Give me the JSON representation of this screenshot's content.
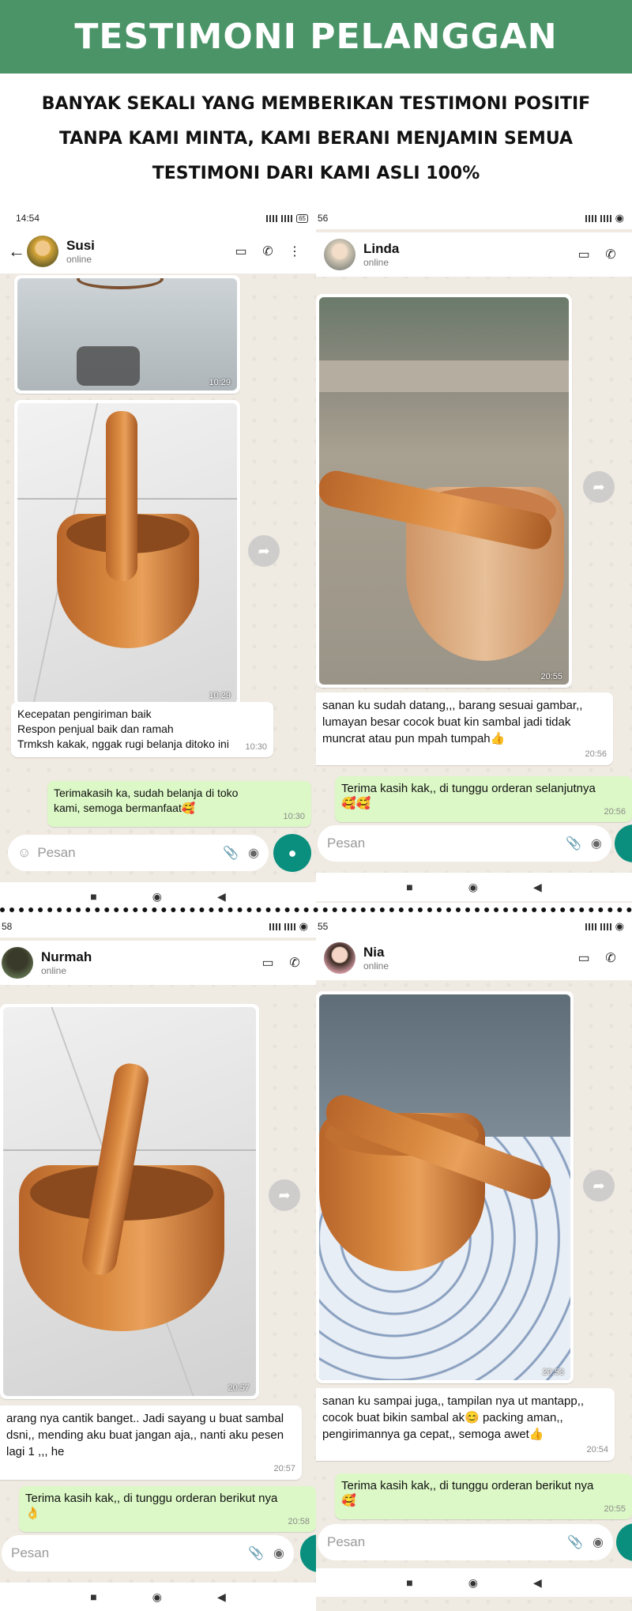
{
  "banner": {
    "title": "TESTIMONI PELANGGAN"
  },
  "subtitle": {
    "line1": "BANYAK SEKALI YANG MEMBERIKAN TESTIMONI POSITIF",
    "line2": "TANPA KAMI MINTA, KAMI BERANI MENJAMIN SEMUA",
    "line3": "TESTIMONI DARI KAMI ASLI 100%"
  },
  "colors": {
    "banner": "#4a9468",
    "incoming": "#ffffff",
    "outgoing": "#dcf8c6",
    "chat_bg": "#efeae2",
    "mic": "#0a8f7e"
  },
  "common": {
    "placeholder": "Pesan",
    "status": "online",
    "back_icon": "arrow-left-icon",
    "video_icon": "video-call-icon",
    "call_icon": "phone-icon"
  },
  "chat1": {
    "clock": "14:54",
    "name": "Susi",
    "status": "online",
    "photo1_time": "10:29",
    "photo2_time": "10:29",
    "msg_in": [
      "Kecepatan pengiriman baik",
      "Respon penjual baik dan ramah",
      "Trmksh kakak, nggak rugi belanja ditoko ini"
    ],
    "msg_in_time": "10:30",
    "msg_out": "Terimakasih ka, sudah belanja di toko kami, semoga bermanfaat🥰",
    "msg_out_time": "10:30"
  },
  "chat2": {
    "clock": "56",
    "name": "Linda",
    "status": "online",
    "photo_time": "20:55",
    "msg_in": "sanan ku sudah datang,,, barang sesuai gambar,, lumayan besar cocok buat kin sambal jadi tidak muncrat atau pun mpah tumpah👍",
    "msg_in_time": "20:56",
    "msg_out": "Terima kasih kak,, di tunggu orderan selanjutnya🥰🥰",
    "msg_out_time": "20:56"
  },
  "chat3": {
    "clock": "58",
    "name": "Nurmah",
    "status": "online",
    "photo_time": "20:57",
    "msg_in": "arang nya cantik banget.. Jadi sayang u buat sambal dsni,, mending aku buat jangan aja,, nanti aku pesen lagi 1 ,,, he",
    "msg_in_time": "20:57",
    "msg_out": "Terima kasih kak,, di tunggu orderan berikut nya👌",
    "msg_out_time": "20:58"
  },
  "chat4": {
    "clock": "55",
    "name": "Nia",
    "status": "online",
    "photo_time": "20:53",
    "msg_in": "sanan ku sampai juga,, tampilan nya ut mantapp,, cocok buat bikin sambal ak😊 packing aman,, pengirimannya ga cepat,, semoga awet👍",
    "msg_in_time": "20:54",
    "msg_out": "Terima kasih kak,, di tunggu orderan berikut nya🥰",
    "msg_out_time": "20:55"
  }
}
